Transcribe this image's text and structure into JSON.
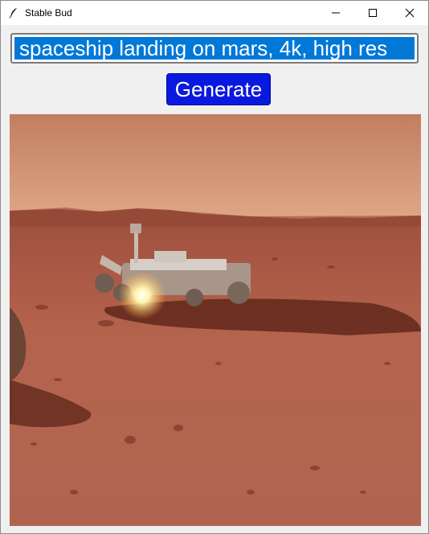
{
  "window": {
    "title": "Stable Bud",
    "icon": "feather-icon",
    "controls": [
      "minimize-icon",
      "maximize-icon",
      "close-icon"
    ]
  },
  "prompt": {
    "value": "spaceship landing on mars, 4k, high res",
    "selected": true
  },
  "generate": {
    "label": "Generate"
  },
  "image": {
    "subject": "rover on martian surface",
    "colors": {
      "sky": "#d89a78",
      "ground": "#b0604a",
      "shadow": "#5e2a1e"
    }
  }
}
